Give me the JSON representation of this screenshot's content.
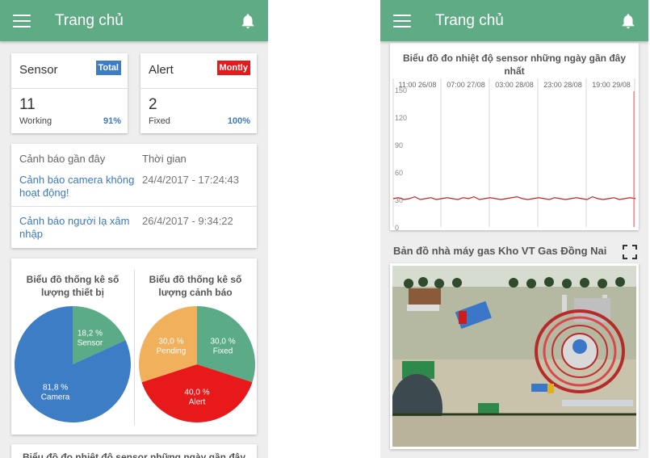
{
  "left": {
    "appbar": {
      "title": "Trang chủ"
    },
    "sensor": {
      "title": "Sensor",
      "badge": "Total",
      "value": "11",
      "label": "Working",
      "percent": "91%"
    },
    "alert": {
      "title": "Alert",
      "badge": "Montly",
      "value": "2",
      "label": "Fixed",
      "percent": "100%"
    },
    "alerts": {
      "col_alert": "Cảnh báo gần đây",
      "col_time": "Thời gian",
      "rows": [
        {
          "message": "Cảnh báo camera không hoạt động!",
          "time": "24/4/2017 - 17:24:43"
        },
        {
          "message": "Cảnh báo người lạ xâm nhập",
          "time": "26/4/2017 - 9:34:22"
        }
      ]
    },
    "device_pie": {
      "title": "Biểu đồ thống kê số lượng thiết bị",
      "slices": [
        {
          "pct": "18,2 %",
          "label": "Sensor",
          "value": 18.2,
          "color": "#5aab86"
        },
        {
          "pct": "81,8 %",
          "label": "Camera",
          "value": 81.8,
          "color": "#3d7dc5"
        }
      ]
    },
    "alert_pie": {
      "title": "Biểu đồ thống kê số lượng cảnh báo",
      "slices": [
        {
          "pct": "30,0 %",
          "label": "Fixed",
          "value": 30.0,
          "color": "#5aab86"
        },
        {
          "pct": "40,0 %",
          "label": "Alert",
          "value": 40.0,
          "color": "#e8191b"
        },
        {
          "pct": "30,0 %",
          "label": "Pending",
          "value": 30.0,
          "color": "#f1b05b"
        }
      ]
    },
    "peek_title": "Biểu đồ đo nhiệt độ sensor những ngày gần đây"
  },
  "right": {
    "appbar": {
      "title": "Trang chủ"
    },
    "temp_chart": {
      "title": "Biểu đồ đo nhiệt độ sensor những ngày gần đây nhất",
      "line_color": "#cc2222"
    },
    "map": {
      "title": "Bản đồ nhà máy gas Kho VT Gas Đồng Nai"
    }
  },
  "chart_data": [
    {
      "type": "pie",
      "title": "Biểu đồ thống kê số lượng thiết bị",
      "categories": [
        "Sensor",
        "Camera"
      ],
      "values": [
        18.2,
        81.8
      ]
    },
    {
      "type": "pie",
      "title": "Biểu đồ thống kê số lượng cảnh báo",
      "categories": [
        "Fixed",
        "Alert",
        "Pending"
      ],
      "values": [
        30.0,
        40.0,
        30.0
      ]
    },
    {
      "type": "line",
      "title": "Biểu đồ đo nhiệt độ sensor những ngày gần đây nhất",
      "x_ticks": [
        "11:00 26/08",
        "07:00 27/08",
        "03:00 28/08",
        "23:00 28/08",
        "19:00 29/08"
      ],
      "y_ticks": [
        150,
        120,
        90,
        60,
        30,
        0
      ],
      "ylim": [
        0,
        150
      ],
      "grid": true,
      "series": [
        {
          "values": [
            31,
            32,
            30,
            31,
            33,
            30,
            31,
            32,
            30,
            31,
            32,
            31,
            30,
            32,
            31,
            33,
            30,
            31,
            32,
            31,
            30,
            31,
            32,
            33,
            31,
            30,
            31,
            32,
            31,
            30,
            32,
            31,
            30,
            31,
            32,
            31,
            30,
            33,
            31,
            30,
            31,
            32,
            30,
            31,
            32,
            31
          ]
        }
      ]
    }
  ]
}
